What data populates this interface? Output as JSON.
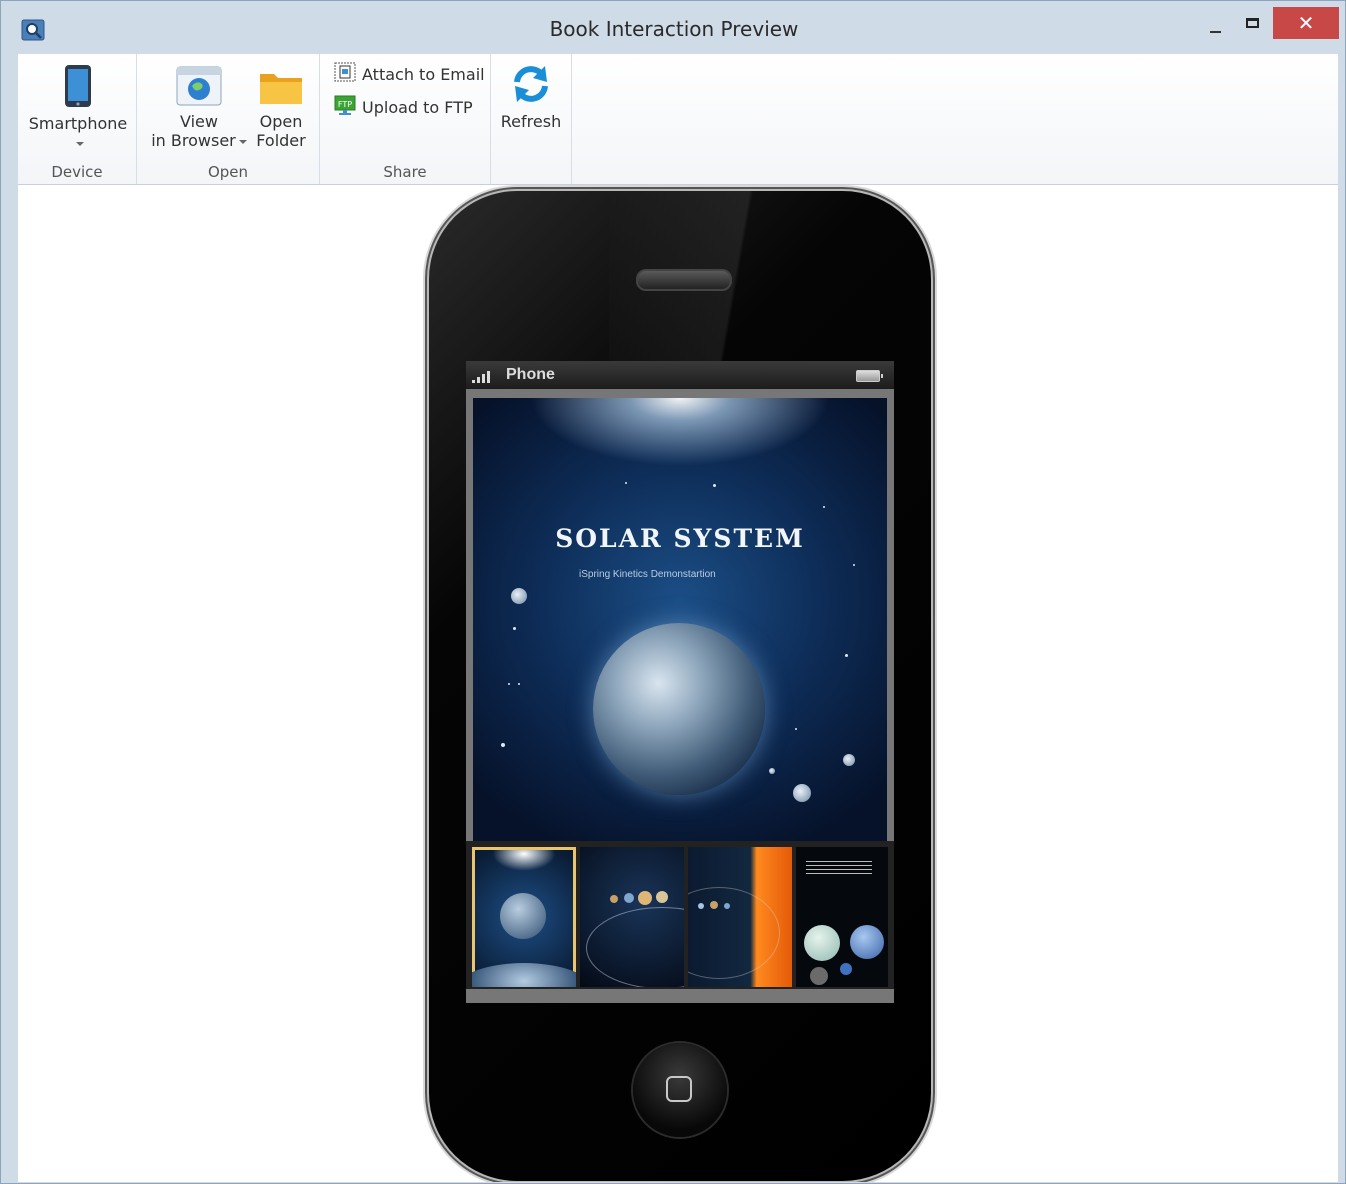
{
  "window": {
    "title": "Book Interaction Preview",
    "close_label": "✕"
  },
  "ribbon": {
    "device": {
      "group_label": "Device",
      "smartphone_label": "Smartphone"
    },
    "open": {
      "group_label": "Open",
      "view_line1": "View",
      "view_line2": "in Browser",
      "open_line1": "Open",
      "open_line2": "Folder"
    },
    "share": {
      "group_label": "Share",
      "attach_email": "Attach to Email",
      "upload_ftp": "Upload to FTP"
    },
    "refresh": {
      "label": "Refresh"
    }
  },
  "phone": {
    "carrier": "Phone",
    "cover_title": "SOLAR SYSTEM",
    "cover_subtitle": "iSpring Kinetics Demonstartion",
    "thumbnails_count": 4,
    "selected_thumbnail": 1
  },
  "colors": {
    "close_button": "#c84747",
    "selected_thumb_border": "#e8c670",
    "refresh_icon": "#1a8fd8"
  }
}
